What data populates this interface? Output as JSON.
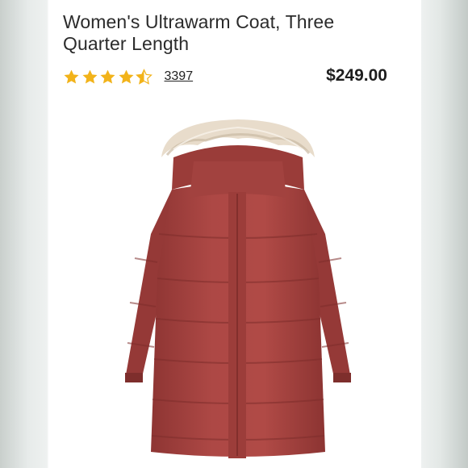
{
  "product": {
    "title": "Women's Ultrawarm Coat, Three Quarter Length",
    "rating": 4.6,
    "rating_max": 5,
    "review_count": "3397",
    "price": "$249.00",
    "image_icon": "red-hooded-parka-image"
  },
  "colors": {
    "star": "#f2b31a",
    "coat": "#a84541",
    "fur": "#e8dccb"
  }
}
